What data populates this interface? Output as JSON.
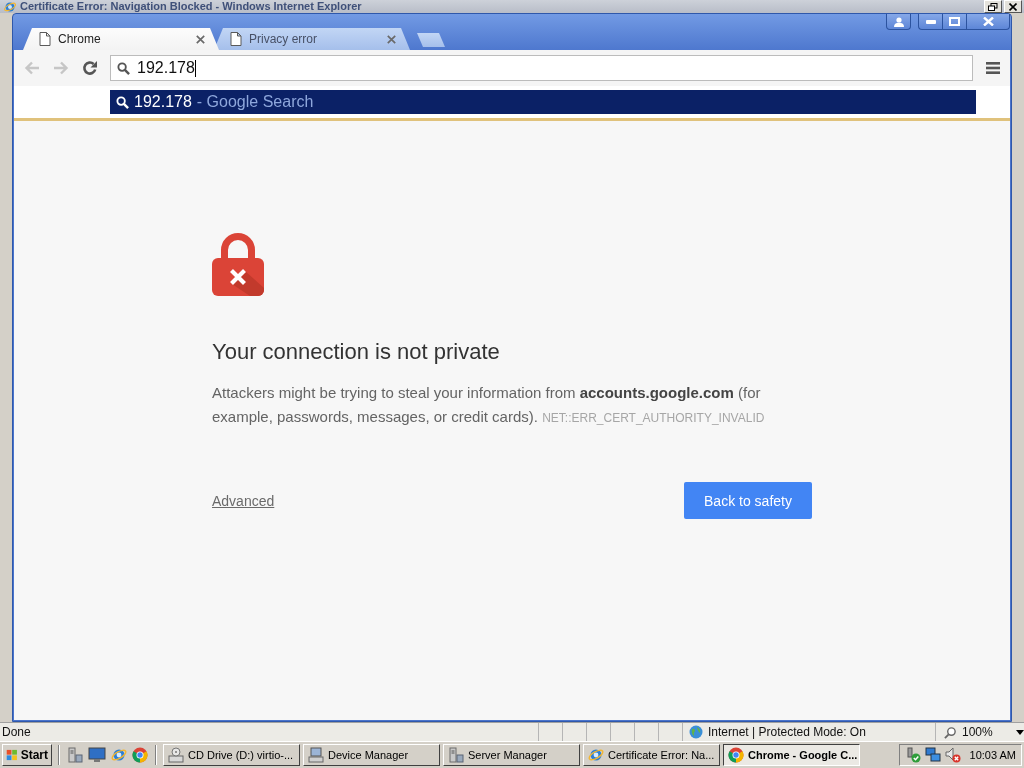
{
  "background_window": {
    "title": "Certificate Error: Navigation Blocked - Windows Internet Explorer",
    "status_bar": {
      "text": "Done",
      "zone": "Internet | Protected Mode: On",
      "zoom": "100%"
    }
  },
  "browser": {
    "tabs": [
      {
        "label": "Chrome",
        "selected": true
      },
      {
        "label": "Privacy error",
        "selected": false
      }
    ],
    "nav_buttons": [
      {
        "kind": "back",
        "disabled": true
      },
      {
        "kind": "forward",
        "disabled": true
      },
      {
        "kind": "reload",
        "disabled": false
      }
    ],
    "address": {
      "value": "192.178"
    },
    "suggestions": [
      {
        "query": "192.178",
        "description": "- Google Search",
        "selected": true
      }
    ]
  },
  "page": {
    "heading": "Your connection is not private",
    "description": "Attackers might be trying to steal your information from **accounts.google.com** (for example, passwords, messages, or credit cards).",
    "error_code": "NET::ERR_CERT_AUTHORITY_INVALID",
    "advanced_link": "Advanced",
    "primary_button": "Back to safety"
  },
  "taskbar": {
    "start": "Start",
    "tasks": [
      {
        "label": "CD Drive (D:) virtio-...",
        "selected": false
      },
      {
        "label": "Device Manager",
        "selected": false
      },
      {
        "label": "Server Manager",
        "selected": false
      },
      {
        "label": "Certificate Error: Na...",
        "selected": false
      },
      {
        "label": "Chrome - Google C...",
        "selected": true
      }
    ],
    "clock": "10:03 AM"
  }
}
